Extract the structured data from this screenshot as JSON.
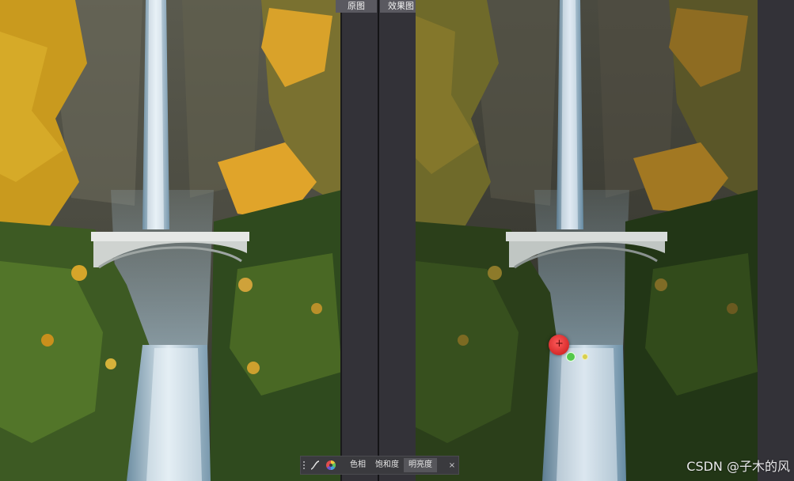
{
  "labels": {
    "original": "原图",
    "effect": "效果图"
  },
  "toolbar": {
    "curve_icon": "curve-icon",
    "color_wheel_icon": "color-wheel-icon",
    "hue": "色相",
    "saturation": "饱和度",
    "brightness": "明亮度",
    "close": "×"
  },
  "markers": [
    "red-target-marker",
    "green-handle-marker",
    "yellow-handle-marker"
  ],
  "watermark": "CSDN @子木的风",
  "colors": {
    "panel_bg": "#2b2a2e",
    "tab_bg": "#5a5960",
    "toolbar_bg": "#3a3a3e"
  }
}
